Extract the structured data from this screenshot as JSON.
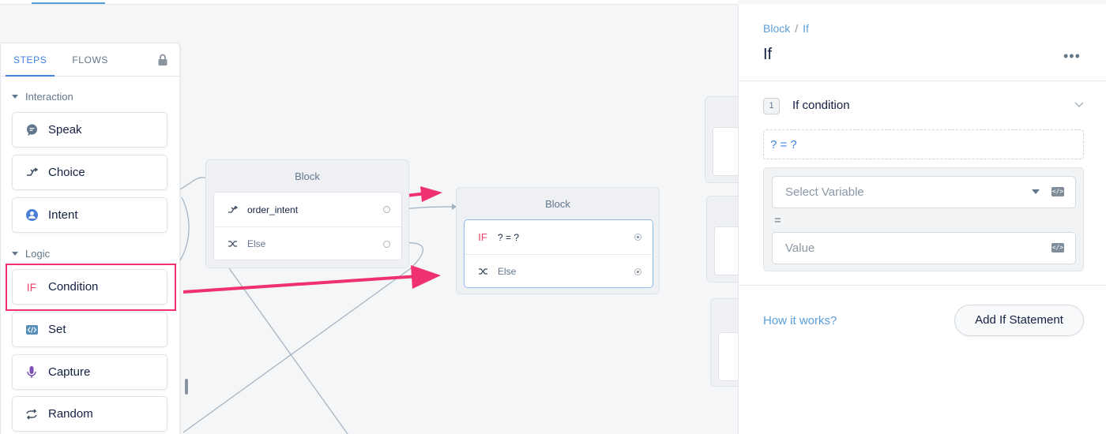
{
  "sidebar": {
    "tabs": [
      "STEPS",
      "FLOWS"
    ],
    "sections": [
      "Interaction",
      "Logic"
    ],
    "steps": [
      {
        "label": "Speak",
        "icon": "speech-bubble-icon"
      },
      {
        "label": "Choice",
        "icon": "branch-icon"
      },
      {
        "label": "Intent",
        "icon": "user-icon"
      },
      {
        "label": "Condition",
        "icon_text": "IF",
        "icon": "if-icon"
      },
      {
        "label": "Set",
        "icon": "code-icon"
      },
      {
        "label": "Capture",
        "icon": "microphone-icon"
      },
      {
        "label": "Random",
        "icon": "shuffle-icon"
      }
    ]
  },
  "canvas": {
    "block1": {
      "title": "Block",
      "rows": [
        "order_intent",
        "Else"
      ]
    },
    "block2": {
      "title": "Block",
      "if_label": "IF",
      "rows": [
        "? = ?",
        "Else"
      ]
    }
  },
  "panel": {
    "breadcrumb": [
      "Block",
      "If"
    ],
    "title": "If",
    "more": "•••",
    "condition_number": "1",
    "condition_label": "If condition",
    "expression": "? = ?",
    "variable_placeholder": "Select Variable",
    "equals": "=",
    "value_placeholder": "Value",
    "var_icon": "</>",
    "how_it_works": "How it works?",
    "add_button": "Add If Statement"
  },
  "colors": {
    "accent": "#3d82e2",
    "highlight": "#f0316f",
    "if_red": "#e8436a"
  }
}
